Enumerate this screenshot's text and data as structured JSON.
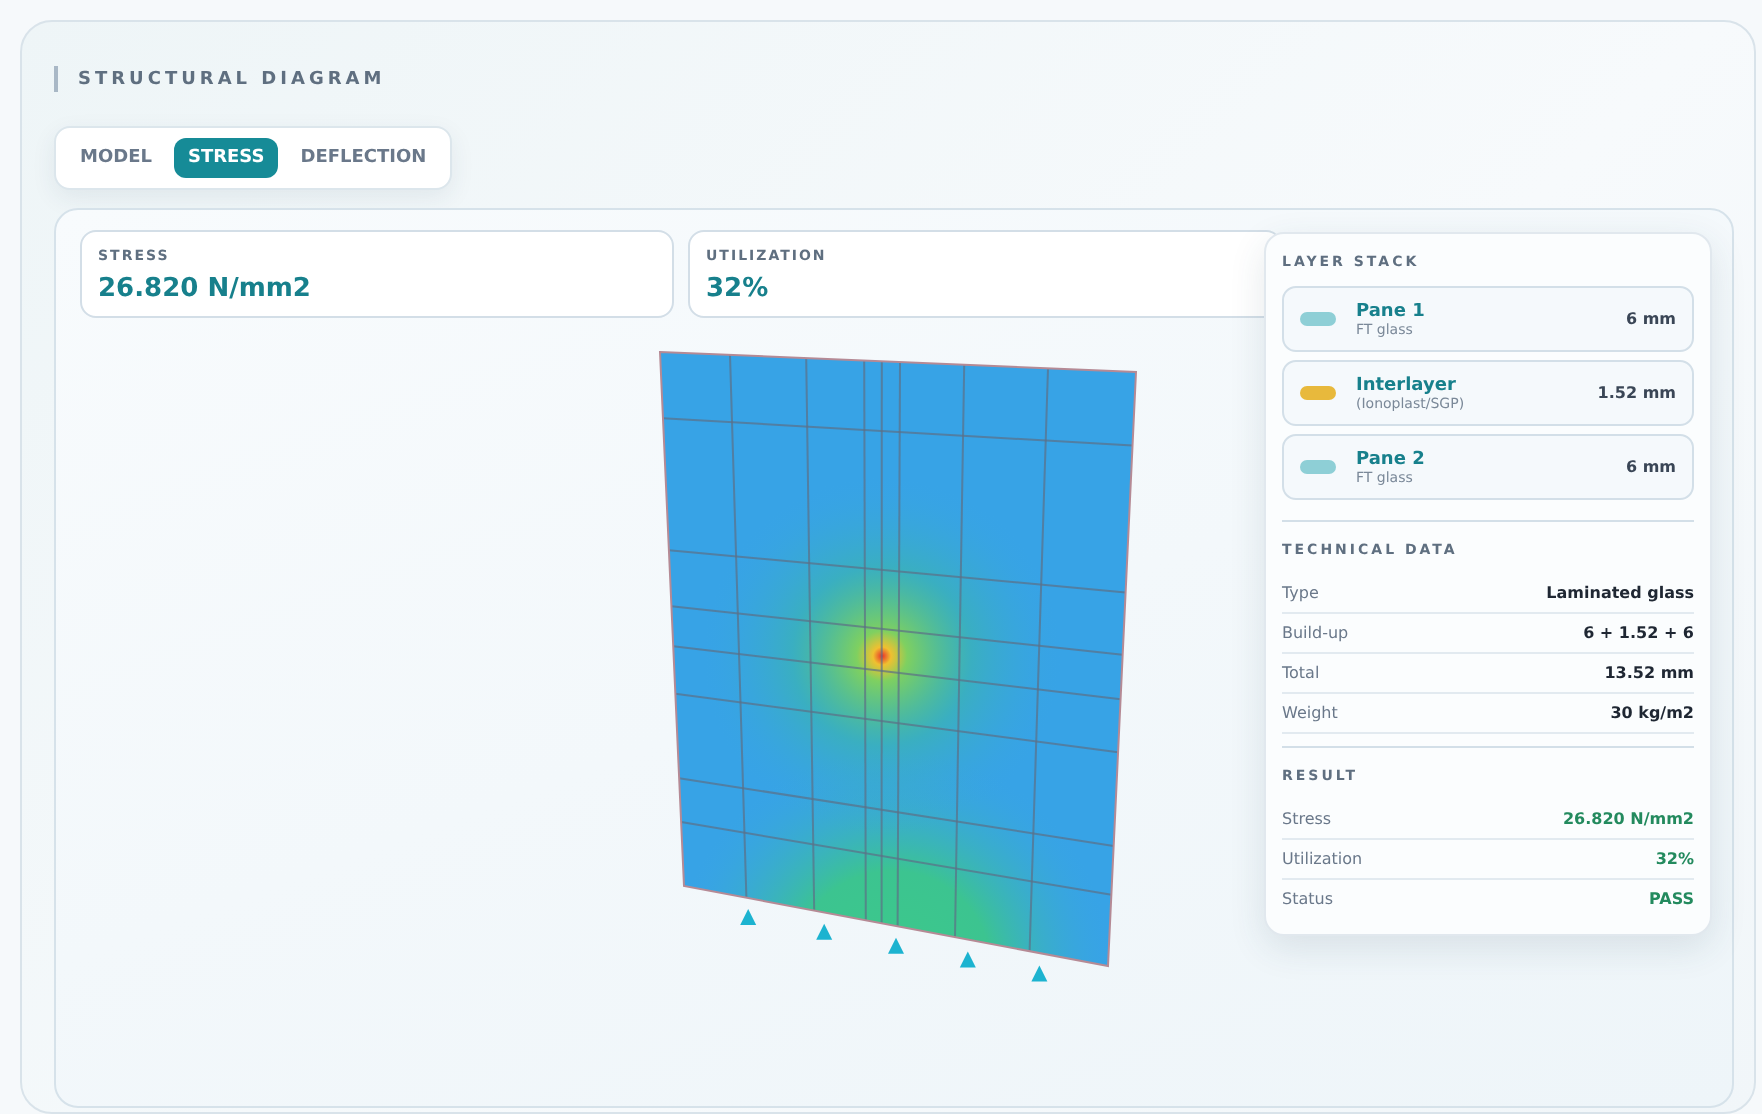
{
  "title": "STRUCTURAL DIAGRAM",
  "tabs": [
    {
      "label": "MODEL",
      "selected": false
    },
    {
      "label": "STRESS",
      "selected": true
    },
    {
      "label": "DEFLECTION",
      "selected": false
    }
  ],
  "stats": [
    {
      "label": "STRESS",
      "value": "26.820 N/mm2"
    },
    {
      "label": "UTILIZATION",
      "value": "32%"
    }
  ],
  "layer_stack": {
    "heading": "LAYER STACK",
    "layers": [
      {
        "name": "Pane 1",
        "material": "FT glass",
        "thickness": "6 mm",
        "color": "#8ecfd6"
      },
      {
        "name": "Interlayer",
        "material": "(Ionoplast/SGP)",
        "thickness": "1.52 mm",
        "color": "#e8b93c"
      },
      {
        "name": "Pane 2",
        "material": "FT glass",
        "thickness": "6 mm",
        "color": "#8ecfd6"
      }
    ]
  },
  "technical_data": {
    "heading": "TECHNICAL DATA",
    "rows": [
      {
        "label": "Type",
        "value": "Laminated glass"
      },
      {
        "label": "Build-up",
        "value": "6 + 1.52 + 6"
      },
      {
        "label": "Total",
        "value": "13.52 mm"
      },
      {
        "label": "Weight",
        "value": "30 kg/m2"
      }
    ]
  },
  "result": {
    "heading": "RESULT",
    "rows": [
      {
        "label": "Stress",
        "value": "26.820 N/mm2"
      },
      {
        "label": "Utilization",
        "value": "32%"
      },
      {
        "label": "Status",
        "value": "PASS"
      }
    ]
  }
}
